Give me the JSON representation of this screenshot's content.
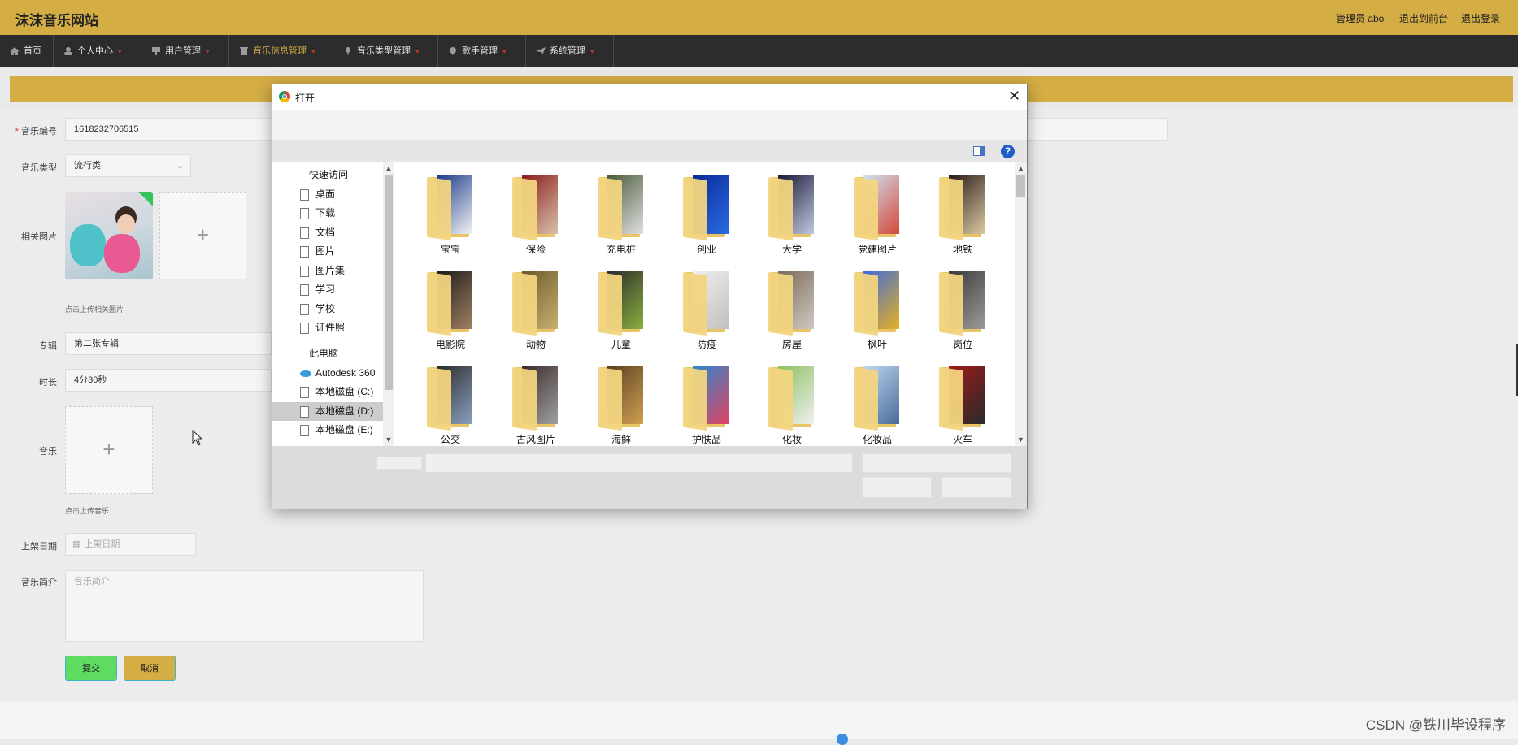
{
  "header": {
    "site_title": "沫沫音乐网站",
    "admin_label": "管理员 abo",
    "front_link": "退出到前台",
    "logout_link": "退出登录"
  },
  "nav": {
    "items": [
      {
        "label": "首页",
        "icon": "home-icon"
      },
      {
        "label": "个人中心",
        "icon": "user-icon"
      },
      {
        "label": "用户管理",
        "icon": "flag-icon"
      },
      {
        "label": "音乐信息管理",
        "icon": "trash-icon",
        "active": true
      },
      {
        "label": "音乐类型管理",
        "icon": "mic-icon"
      },
      {
        "label": "歌手管理",
        "icon": "pin-icon"
      },
      {
        "label": "系统管理",
        "icon": "send-icon"
      }
    ]
  },
  "form": {
    "music_no_label": "音乐编号",
    "music_no_value": "1618232706515",
    "type_label": "音乐类型",
    "type_value": "流行类",
    "image_label": "相关图片",
    "image_hint": "点击上传相关图片",
    "album_label": "专辑",
    "album_value": "第二张专辑",
    "duration_label": "时长",
    "duration_value": "4分30秒",
    "music_label": "音乐",
    "music_hint": "点击上传音乐",
    "date_label": "上架日期",
    "date_placeholder": "上架日期",
    "intro_label": "音乐简介",
    "intro_placeholder": "音乐简介",
    "submit": "提交",
    "cancel": "取消"
  },
  "dialog": {
    "title": "打开",
    "sidebar": {
      "quick_access": "快速访问",
      "quick_items": [
        "桌面",
        "下载",
        "文档",
        "图片",
        "图片集",
        "学习",
        "学校",
        "证件照"
      ],
      "this_pc": "此电脑",
      "pc_items": [
        "Autodesk 360",
        "本地磁盘 (C:)",
        "本地磁盘 (D:)",
        "本地磁盘 (E:)"
      ],
      "selected": "本地磁盘 (D:)"
    },
    "folders": [
      "宝宝",
      "保险",
      "充电桩",
      "创业",
      "大学",
      "党建图片",
      "地铁",
      "电影院",
      "动物",
      "儿童",
      "防疫",
      "房屋",
      "枫叶",
      "岗位",
      "公交",
      "古风图片",
      "海鲜",
      "护肤品",
      "化妆",
      "化妆品",
      "火车"
    ]
  },
  "watermark": "CSDN @铁川毕设程序",
  "colors": {
    "gold": "#d4ad45",
    "nav_bg": "#2c2c2c",
    "submit_green": "#5fdc5f",
    "cancel_gold": "#d4ad45"
  }
}
